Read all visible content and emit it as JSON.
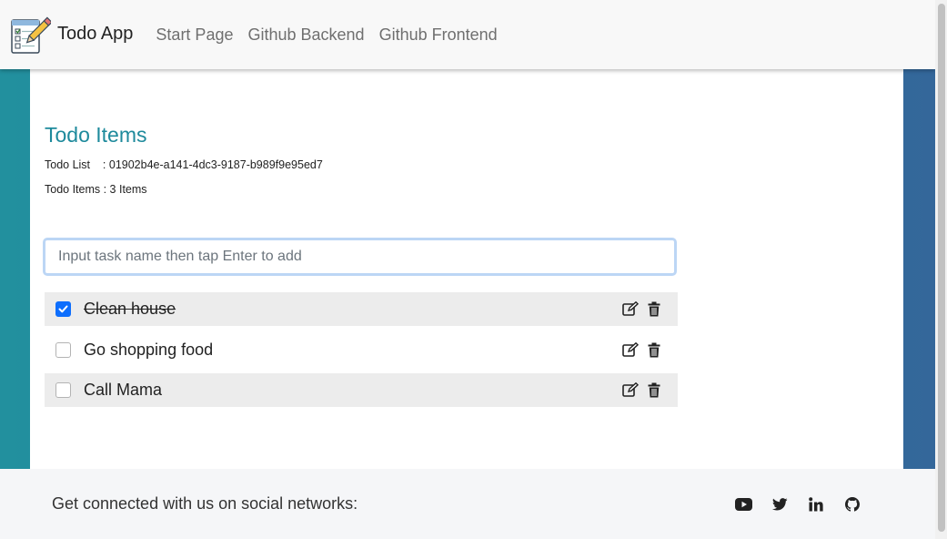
{
  "navbar": {
    "brand": "Todo App",
    "logo_icon": "todo-notepad-pencil-icon",
    "links": [
      {
        "label": "Start Page"
      },
      {
        "label": "Github Backend"
      },
      {
        "label": "Github Frontend"
      }
    ]
  },
  "main": {
    "title": "Todo Items",
    "todo_list_line": "Todo List    : 01902b4e-a141-4dc3-9187-b989f9e95ed7",
    "todo_items_line": "Todo Items : 3 Items",
    "input": {
      "placeholder": "Input task name then tap Enter to add",
      "value": ""
    },
    "items": [
      {
        "name": "Clean house",
        "completed": true
      },
      {
        "name": "Go shopping food",
        "completed": false
      },
      {
        "name": "Call Mama",
        "completed": false
      }
    ],
    "item_action_icons": [
      "edit-icon",
      "trash-icon"
    ]
  },
  "footer": {
    "text": "Get connected with us on social networks:",
    "social_icons": [
      "youtube-icon",
      "twitter-icon",
      "linkedin-icon",
      "github-icon"
    ]
  },
  "colors": {
    "title": "#1e8a9c",
    "checkbox_checked": "#0d6efd",
    "gradient_left": "#22909e",
    "gradient_right": "#34669a"
  }
}
